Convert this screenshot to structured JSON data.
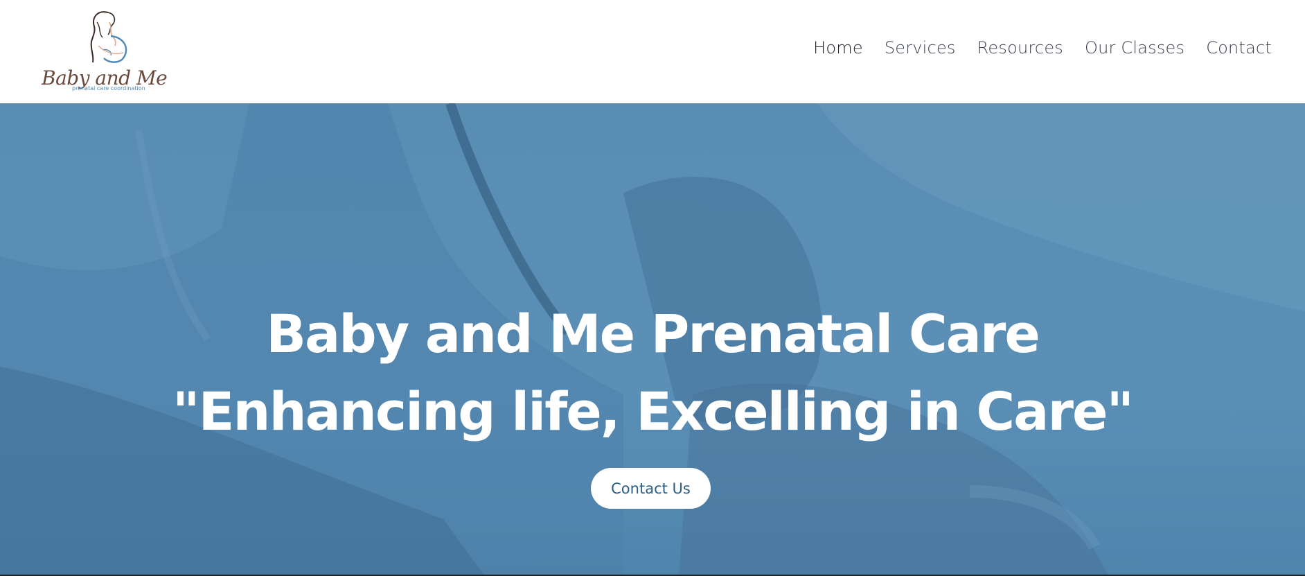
{
  "brand": {
    "name": "Baby and Me",
    "tagline": "prenatal care coordination",
    "logo_icon": "mother-silhouette-icon"
  },
  "nav": {
    "items": [
      {
        "label": "Home",
        "active": true
      },
      {
        "label": "Services",
        "active": false
      },
      {
        "label": "Resources",
        "active": false
      },
      {
        "label": "Our Classes",
        "active": false
      },
      {
        "label": "Contact",
        "active": false
      }
    ]
  },
  "hero": {
    "title_line1": "Baby and Me Prenatal Care",
    "title_line2": "\"Enhancing life, Excelling in Care\"",
    "cta_label": "Contact Us",
    "overlay_color": "#5a8db3"
  },
  "colors": {
    "accent": "#5a8db3",
    "nav_text": "#3b3f50",
    "cta_text": "#2b5d82"
  }
}
